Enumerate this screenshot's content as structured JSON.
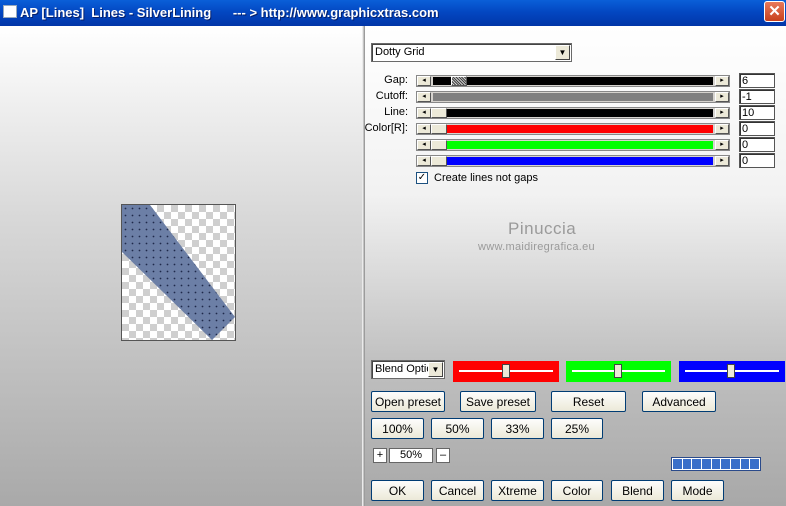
{
  "window": {
    "title": "AP [Lines]  Lines - SilverLining      --- > http://www.graphicxtras.com",
    "close_glyph": "✕"
  },
  "preset_dropdown": {
    "value": "Dotty Grid"
  },
  "sliders": [
    {
      "label": "Gap:",
      "value": "6",
      "track_color": "#000000"
    },
    {
      "label": "Cutoff:",
      "value": "-1",
      "track_color": "#808080"
    },
    {
      "label": "Line:",
      "value": "10",
      "track_color": "#000000"
    },
    {
      "label": "Color[R]:",
      "value": "0",
      "track_color": "#ff0000"
    },
    {
      "label": "",
      "value": "0",
      "track_color": "#00ff00"
    },
    {
      "label": "",
      "value": "0",
      "track_color": "#0000ff"
    }
  ],
  "checkbox": {
    "label": "Create lines not gaps",
    "checked": true,
    "glyph": "✓"
  },
  "watermark": {
    "name": "Pinuccia",
    "url": "www.maidiregrafica.eu"
  },
  "blend_dropdown": {
    "value": "Blend Optio"
  },
  "color_boxes": [
    "#ff0000",
    "#00ff00",
    "#0000ff"
  ],
  "preset_buttons": {
    "open": "Open preset",
    "save": "Save preset",
    "reset": "Reset",
    "advanced": "Advanced"
  },
  "zoom_buttons": [
    "100%",
    "50%",
    "33%",
    "25%"
  ],
  "zoom": {
    "plus": "+",
    "value": "50%",
    "minus": "–"
  },
  "bottom_buttons": {
    "ok": "OK",
    "cancel": "Cancel",
    "xtreme": "Xtreme",
    "color": "Color",
    "blend": "Blend",
    "mode": "Mode"
  },
  "progress": {
    "segments": 9,
    "filled": 9
  },
  "preview": {
    "stripe_color": "#6c7fa6",
    "dot_color": "#1e2a4a"
  }
}
